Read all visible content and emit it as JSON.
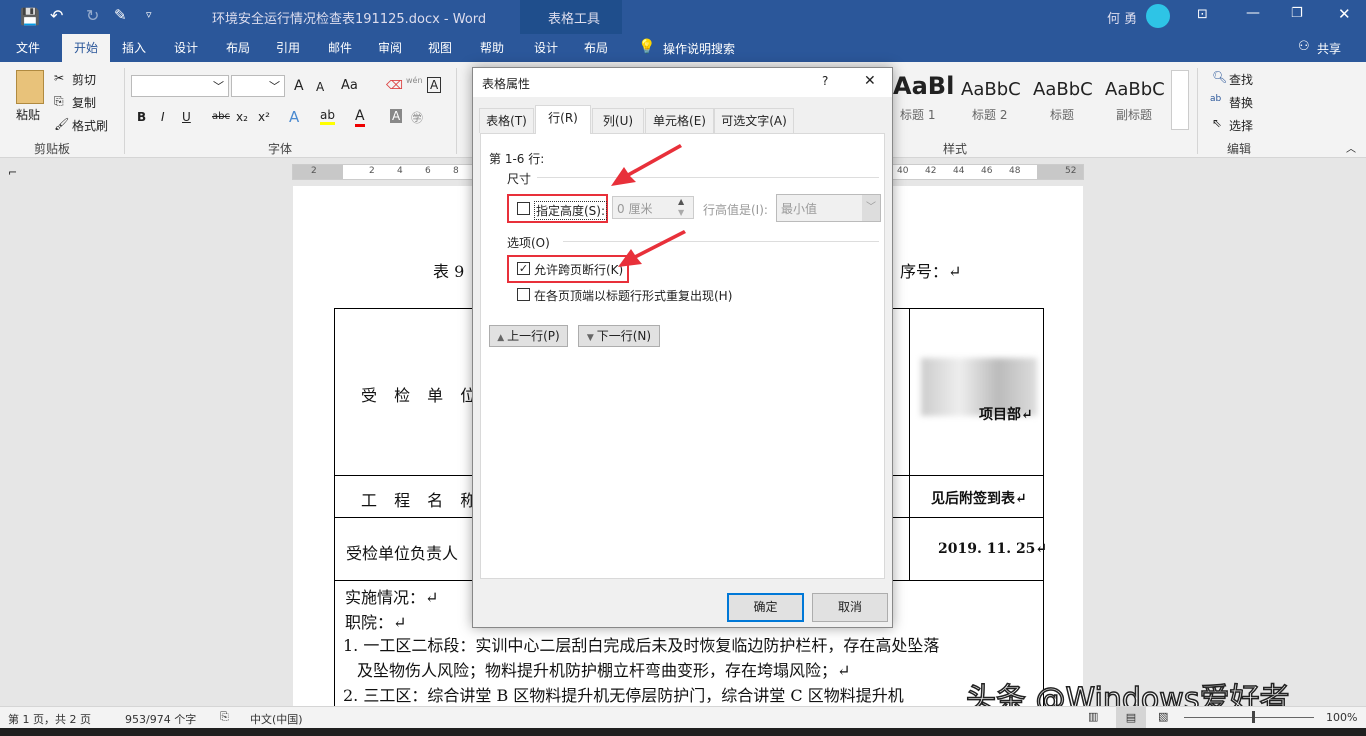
{
  "titlebar": {
    "doc_title": "环境安全运行情况检查表191125.docx  -  Word",
    "context_tab": "表格工具",
    "user": "何 勇"
  },
  "tabs": [
    "文件",
    "开始",
    "插入",
    "设计",
    "布局",
    "引用",
    "邮件",
    "审阅",
    "视图",
    "帮助",
    "设计",
    "布局"
  ],
  "tell_me": "操作说明搜索",
  "share": "共享",
  "ribbon": {
    "clipboard": {
      "paste": "粘贴",
      "cut": "剪切",
      "copy": "复制",
      "format_painter": "格式刷",
      "label": "剪贴板"
    },
    "font": {
      "label": "字体",
      "bold": "B",
      "italic": "I",
      "underline": "U",
      "strike": "abc",
      "sub": "x₂",
      "sup": "x²",
      "grow": "A",
      "shrink": "A",
      "case": "Aa",
      "phonetic": "wén",
      "border": "A"
    },
    "styles": {
      "label": "样式",
      "items": [
        {
          "preview": "AaBl",
          "name": "标题 1"
        },
        {
          "preview": "AaBbC",
          "name": "标题 2"
        },
        {
          "preview": "AaBbC",
          "name": "标题"
        },
        {
          "preview": "AaBbC",
          "name": "副标题"
        }
      ]
    },
    "editing": {
      "label": "编辑",
      "find": "查找",
      "replace": "替换",
      "select": "选择"
    }
  },
  "ruler": {
    "left": [
      "2",
      "2",
      "4",
      "6",
      "8"
    ],
    "right": [
      "40",
      "42",
      "44",
      "46",
      "48",
      "52"
    ]
  },
  "document": {
    "title_left": "表 9",
    "title_right": "序号：↵",
    "rows": [
      {
        "label": "受 检 单 位",
        "value": "项目部↵"
      },
      {
        "label": "工 程 名 称",
        "value": "见后附签到表↵"
      },
      {
        "label": "受检单位负责人",
        "value": "2019. 11. 25↵"
      }
    ],
    "lines": [
      "实施情况：↵",
      "职院：↵",
      "1. 一工区二标段：实训中心二层刮白完成后未及时恢复临边防护栏杆，存在高处坠落",
      "及坠物伤人风险；物料提升机防护棚立杆弯曲变形，存在垮塌风险；↵",
      "2. 三工区：综合讲堂 B 区物料提升机无停层防护门，综合讲堂 C 区物料提升机"
    ]
  },
  "dialog": {
    "title": "表格属性",
    "help": "?",
    "tabs": [
      "表格(T)",
      "行(R)",
      "列(U)",
      "单元格(E)",
      "可选文字(A)"
    ],
    "active_tab": 1,
    "rows_label": "第 1-6 行:",
    "size_section": "尺寸",
    "specify_height": "指定高度(S):",
    "specify_height_checked": false,
    "height_value": "0 厘米",
    "row_height_is": "行高值是(I):",
    "row_height_mode": "最小值",
    "options_section": "选项(O)",
    "allow_break": "允许跨页断行(K)",
    "allow_break_checked": true,
    "repeat_header": "在各页顶端以标题行形式重复出现(H)",
    "repeat_header_checked": false,
    "prev_row": "上一行(P)",
    "next_row": "下一行(N)",
    "ok": "确定",
    "cancel": "取消"
  },
  "status": {
    "page": "第 1 页，共 2 页",
    "words": "953/974 个字",
    "language": "中文(中国)",
    "zoom": "100%",
    "zoom_percent": 100
  },
  "watermark": "头条 @Windows爱好者",
  "colors": {
    "brand": "#2b579a",
    "annotation": "#e8303a"
  }
}
